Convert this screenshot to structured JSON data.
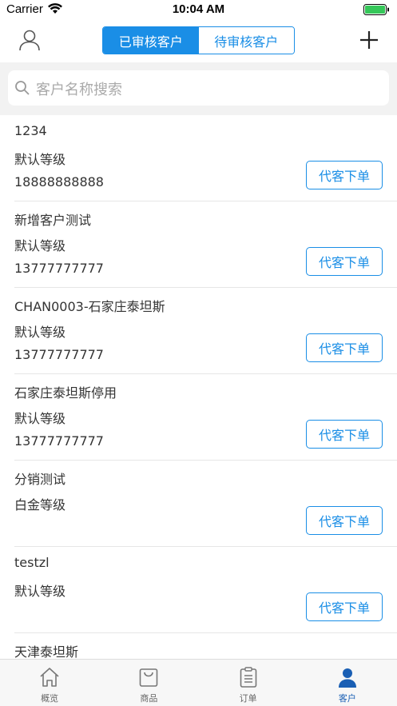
{
  "status_bar": {
    "carrier": "Carrier",
    "time": "10:04 AM"
  },
  "header": {
    "tabs": [
      {
        "label": "已审核客户",
        "active": true
      },
      {
        "label": "待审核客户",
        "active": false
      }
    ]
  },
  "search": {
    "placeholder": "客户名称搜索"
  },
  "customers": [
    {
      "name": "1234",
      "level": "默认等级",
      "phone": "18888888888",
      "action": "代客下单"
    },
    {
      "name": "新增客户测试",
      "level": "默认等级",
      "phone": "13777777777",
      "action": "代客下单"
    },
    {
      "name": "CHAN0003-石家庄泰坦斯",
      "level": "默认等级",
      "phone": "13777777777",
      "action": "代客下单"
    },
    {
      "name": "石家庄泰坦斯停用",
      "level": "默认等级",
      "phone": "13777777777",
      "action": "代客下单"
    },
    {
      "name": "分销测试",
      "level": "白金等级",
      "phone": "",
      "action": "代客下单"
    },
    {
      "name": "testzl",
      "level": "默认等级",
      "phone": "",
      "action": "代客下单"
    },
    {
      "name": "天津泰坦斯",
      "level": "",
      "phone": "",
      "action": ""
    }
  ],
  "tabbar": [
    {
      "label": "概览",
      "icon": "home-icon",
      "active": false
    },
    {
      "label": "商品",
      "icon": "bag-icon",
      "active": false
    },
    {
      "label": "订单",
      "icon": "clipboard-icon",
      "active": false
    },
    {
      "label": "客户",
      "icon": "person-icon",
      "active": true
    }
  ],
  "colors": {
    "accent": "#1a8ee6",
    "active_tab": "#1a5fb4"
  }
}
